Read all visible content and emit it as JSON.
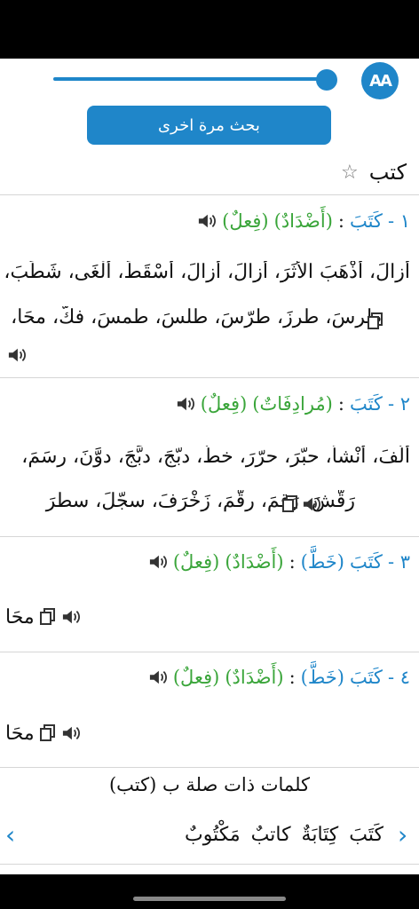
{
  "toolbar": {
    "font_button_label": "AA",
    "slider_level": 1.0,
    "search_again_label": "بحث مرة اخرى"
  },
  "query": {
    "word": "كتب",
    "star_icon": "star-outline-icon"
  },
  "entries": [
    {
      "number": "١ -",
      "word": "كَتَبَ",
      "qualifier": "",
      "relation": "(أَضْدَادٌ)",
      "pos": "(فِعلٌ)",
      "lines": [
        "أزالَ، أَذْهَبَ الأَثَرَ، أَزالَ، أَزالَ، أَسْقَطَ، أَلْغَى، شَطَبَ،",
        "طرسَ، طرزَ، طرّسَ، طلسَ، طمسَ، فكّ، محَا، محَا"
      ]
    },
    {
      "number": "٢ -",
      "word": "كَتَبَ",
      "qualifier": "",
      "relation": "(مُرادِفَاتٌ)",
      "pos": "(فِعلٌ)",
      "lines": [
        "أَلَّفَ، أَنْشأَ، حبّرَ، حرّرَ، خطَّ، دبّجَ، دبَّجَ، دوَّنَ، رسَمَ،",
        "رَقّشَ، رَقمَ، رقّمَ، زَخْرَفَ، سجّلَ، سطرَ"
      ]
    },
    {
      "number": "٣ -",
      "word": "كَتَبَ",
      "qualifier": "(خَطَّ)",
      "relation": "(أَضْدَادٌ)",
      "pos": "(فِعلٌ)",
      "lines": [
        "محَا"
      ]
    },
    {
      "number": "٤ -",
      "word": "كَتَبَ",
      "qualifier": "(خَطَّ)",
      "relation": "(أَضْدَادٌ)",
      "pos": "(فِعلٌ)",
      "lines": [
        "محَا"
      ]
    }
  ],
  "related": {
    "title": "كلمات ذات صلة ب (كتب)",
    "words": [
      "كَتَبَ",
      "كِتَابَةٌ",
      "كاتبٌ",
      "مَكْتُوبٌ"
    ]
  },
  "colors": {
    "accent": "#1f86c9",
    "green": "#3aa53a"
  }
}
